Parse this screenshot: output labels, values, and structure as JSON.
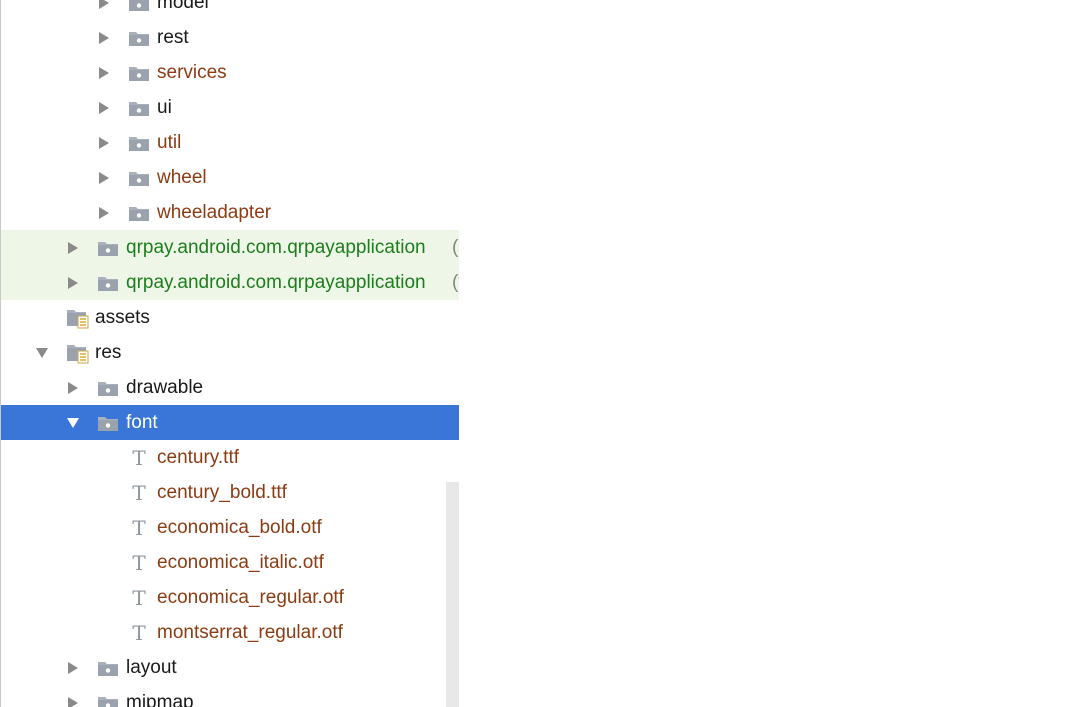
{
  "tree": {
    "rows": [
      {
        "label": "model",
        "indent": 2,
        "expander": "collapsed",
        "icon": "package-folder-icon",
        "style": "dark",
        "highlight": "none"
      },
      {
        "label": "rest",
        "indent": 2,
        "expander": "collapsed",
        "icon": "package-folder-icon",
        "style": "dark",
        "highlight": "none"
      },
      {
        "label": "services",
        "indent": 2,
        "expander": "collapsed",
        "icon": "package-folder-icon",
        "style": "brown",
        "highlight": "none"
      },
      {
        "label": "ui",
        "indent": 2,
        "expander": "collapsed",
        "icon": "package-folder-icon",
        "style": "dark",
        "highlight": "none"
      },
      {
        "label": "util",
        "indent": 2,
        "expander": "collapsed",
        "icon": "package-folder-icon",
        "style": "brown",
        "highlight": "none"
      },
      {
        "label": "wheel",
        "indent": 2,
        "expander": "collapsed",
        "icon": "package-folder-icon",
        "style": "brown",
        "highlight": "none"
      },
      {
        "label": "wheeladapter",
        "indent": 2,
        "expander": "collapsed",
        "icon": "package-folder-icon",
        "style": "brown",
        "highlight": "none"
      },
      {
        "label": "qrpay.android.com.qrpayapplication",
        "suffix": "(a",
        "indent": 1,
        "expander": "collapsed",
        "icon": "package-folder-icon",
        "style": "green",
        "highlight": "green"
      },
      {
        "label": "qrpay.android.com.qrpayapplication",
        "suffix": "(t",
        "indent": 1,
        "expander": "collapsed",
        "icon": "package-folder-icon",
        "style": "green",
        "highlight": "green"
      },
      {
        "label": "assets",
        "indent": 0,
        "expander": "none",
        "icon": "resource-folder-icon",
        "style": "dark",
        "highlight": "none"
      },
      {
        "label": "res",
        "indent": 0,
        "expander": "expanded",
        "icon": "resource-folder-icon",
        "style": "dark",
        "highlight": "none"
      },
      {
        "label": "drawable",
        "indent": 1,
        "expander": "collapsed",
        "icon": "package-folder-icon",
        "style": "dark",
        "highlight": "none"
      },
      {
        "label": "font",
        "indent": 1,
        "expander": "expanded",
        "icon": "package-folder-icon",
        "style": "white",
        "highlight": "selected"
      },
      {
        "label": "century.ttf",
        "indent": 2,
        "expander": "none",
        "icon": "font-file-icon",
        "style": "brown",
        "highlight": "none"
      },
      {
        "label": "century_bold.ttf",
        "indent": 2,
        "expander": "none",
        "icon": "font-file-icon",
        "style": "brown",
        "highlight": "none"
      },
      {
        "label": "economica_bold.otf",
        "indent": 2,
        "expander": "none",
        "icon": "font-file-icon",
        "style": "brown",
        "highlight": "none"
      },
      {
        "label": "economica_italic.otf",
        "indent": 2,
        "expander": "none",
        "icon": "font-file-icon",
        "style": "brown",
        "highlight": "none"
      },
      {
        "label": "economica_regular.otf",
        "indent": 2,
        "expander": "none",
        "icon": "font-file-icon",
        "style": "brown",
        "highlight": "none"
      },
      {
        "label": "montserrat_regular.otf",
        "indent": 2,
        "expander": "none",
        "icon": "font-file-icon",
        "style": "brown",
        "highlight": "none"
      },
      {
        "label": "layout",
        "indent": 1,
        "expander": "collapsed",
        "icon": "package-folder-icon",
        "style": "dark",
        "highlight": "none"
      },
      {
        "label": "mipmap",
        "indent": 1,
        "expander": "collapsed",
        "icon": "package-folder-icon",
        "style": "dark",
        "highlight": "none"
      }
    ]
  },
  "colors": {
    "selected_bg": "#3a76d8",
    "green_bg": "#eef7e7",
    "brown_text": "#8c3c12",
    "green_text": "#1e7d1e"
  }
}
